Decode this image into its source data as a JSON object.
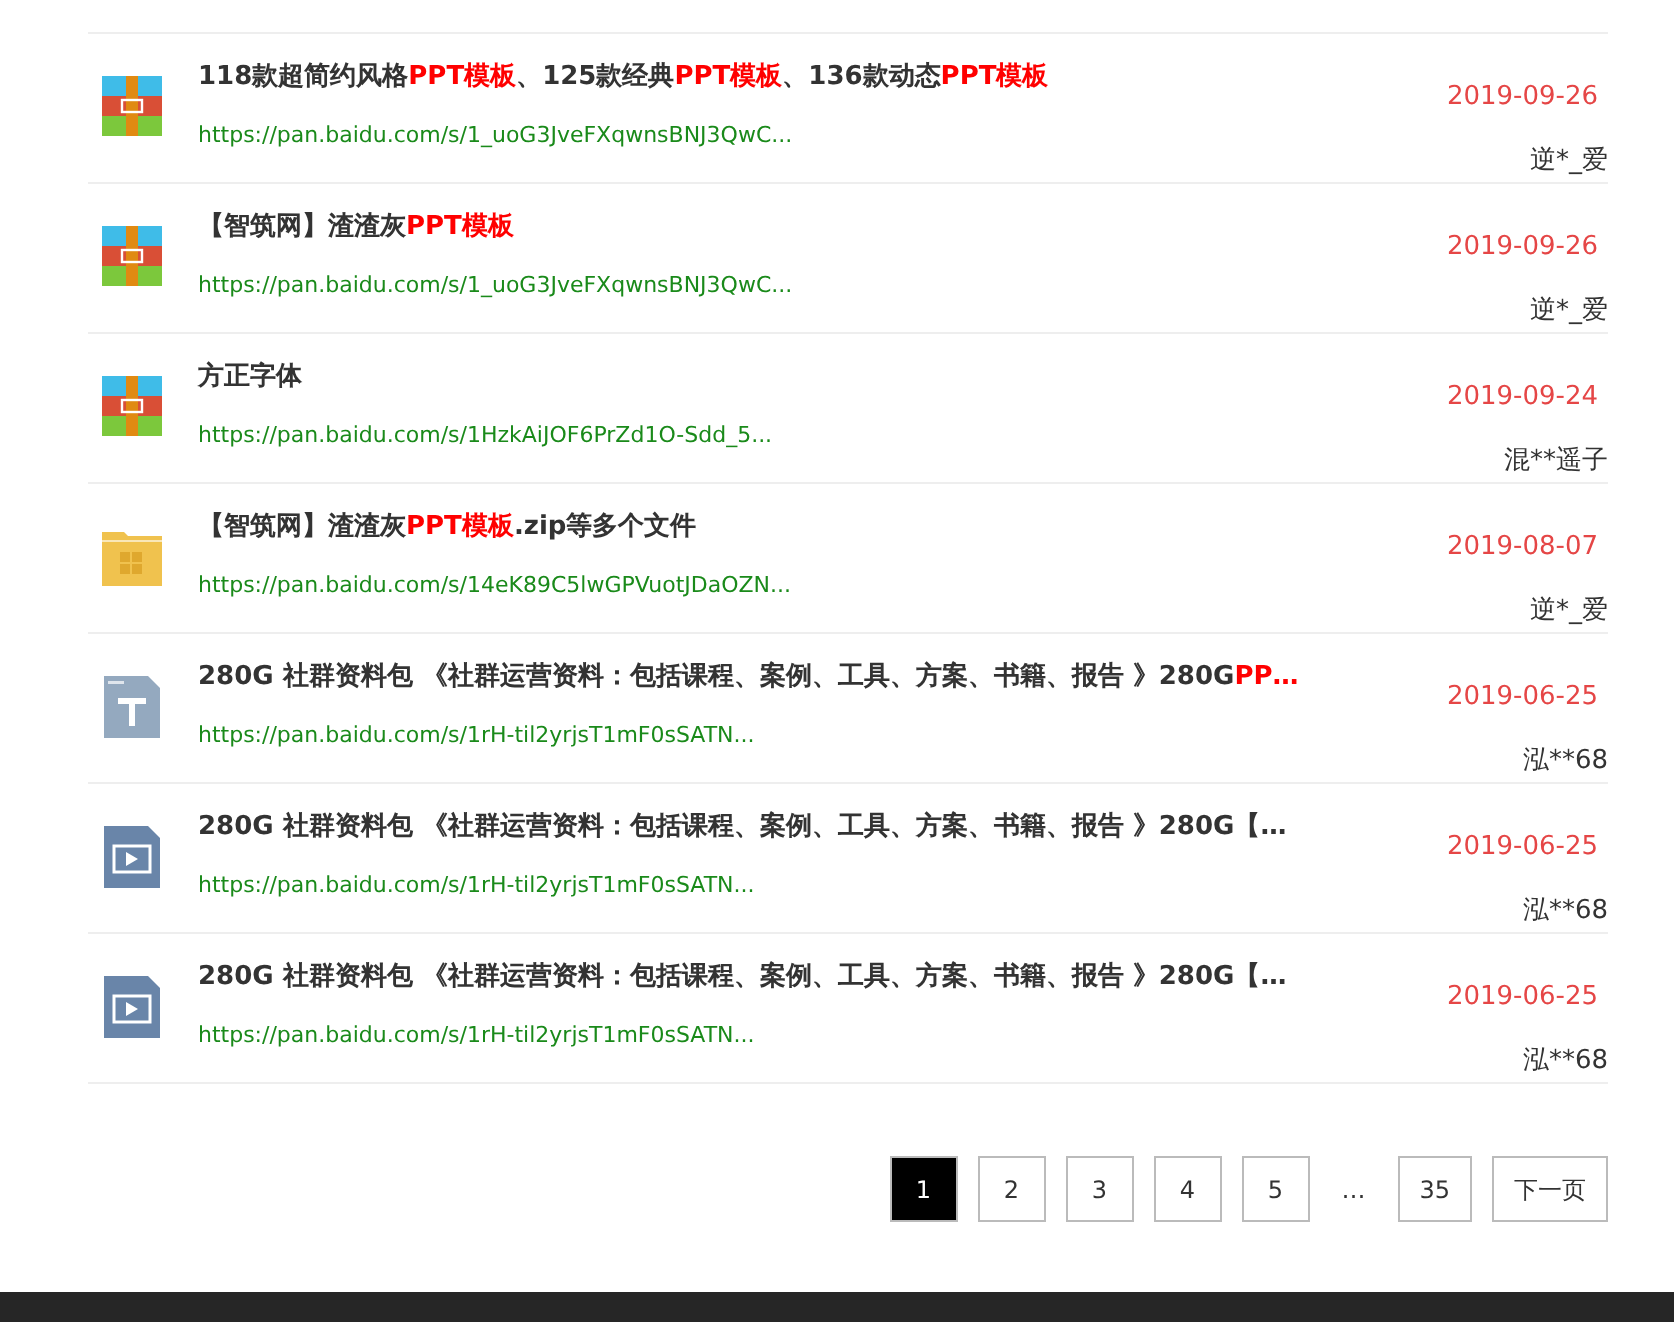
{
  "files": [
    {
      "kind": "archive",
      "title": "118款超简约风格**PPT模板**、125款经典**PPT模板**、136款动态**PPT模板**",
      "url": "https://pan.baidu.com/s/1_uoG3JveFXqwnsBNJ3QwC...",
      "date": "2019-09-26",
      "author": "逆*_爱"
    },
    {
      "kind": "archive",
      "title": "【智筑网】渣渣灰**PPT模板**",
      "url": "https://pan.baidu.com/s/1_uoG3JveFXqwnsBNJ3QwC...",
      "date": "2019-09-26",
      "author": "逆*_爱"
    },
    {
      "kind": "archive",
      "title": "方正字体",
      "url": "https://pan.baidu.com/s/1HzkAiJOF6PrZd1O-Sdd_5...",
      "date": "2019-09-24",
      "author": "混**遥子"
    },
    {
      "kind": "folder",
      "title": "【智筑网】渣渣灰**PPT模板**.zip等多个文件",
      "url": "https://pan.baidu.com/s/14eK89C5lwGPVuotJDaOZN...",
      "date": "2019-08-07",
      "author": "逆*_爱"
    },
    {
      "kind": "text",
      "title": "280G 社群资料包 《社群运营资料：包括课程、案例、工具、方案、书籍、报告 》280G**PP…**",
      "url": "https://pan.baidu.com/s/1rH-til2yrjsT1mF0sSATN...",
      "date": "2019-06-25",
      "author": "泓**68"
    },
    {
      "kind": "video",
      "title": "280G 社群资料包 《社群运营资料：包括课程、案例、工具、方案、书籍、报告 》280G【…",
      "url": "https://pan.baidu.com/s/1rH-til2yrjsT1mF0sSATN...",
      "date": "2019-06-25",
      "author": "泓**68"
    },
    {
      "kind": "video",
      "title": "280G 社群资料包 《社群运营资料：包括课程、案例、工具、方案、书籍、报告 》280G【…",
      "url": "https://pan.baidu.com/s/1rH-til2yrjsT1mF0sSATN...",
      "date": "2019-06-25",
      "author": "泓**68"
    }
  ],
  "pagination": [
    {
      "kind": "page",
      "label": "1",
      "selected": true
    },
    {
      "kind": "page",
      "label": "2",
      "selected": false
    },
    {
      "kind": "page",
      "label": "3",
      "selected": false
    },
    {
      "kind": "page",
      "label": "4",
      "selected": false
    },
    {
      "kind": "page",
      "label": "5",
      "selected": false
    },
    {
      "kind": "ellipsis",
      "label": "…"
    },
    {
      "kind": "page",
      "label": "35",
      "selected": false
    },
    {
      "kind": "next",
      "label": "下一页"
    }
  ]
}
